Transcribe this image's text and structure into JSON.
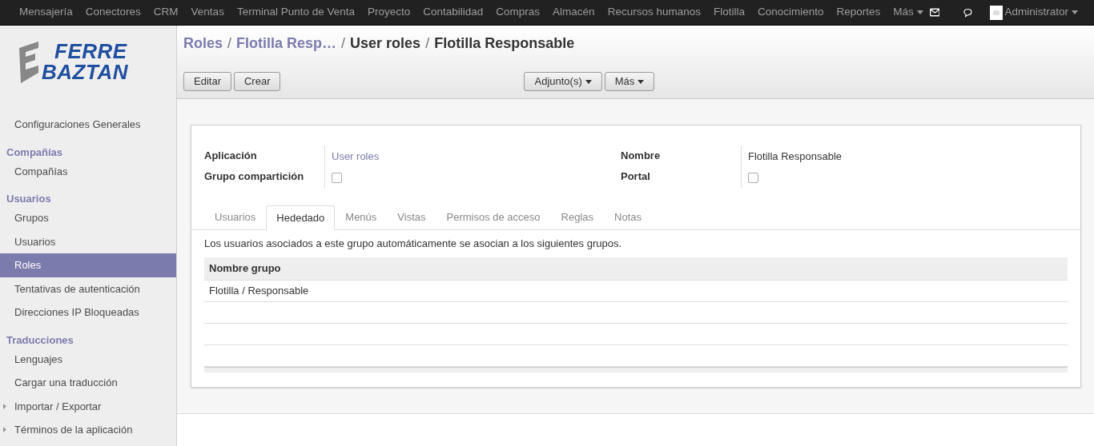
{
  "topbar": {
    "menu": [
      "Mensajería",
      "Conectores",
      "CRM",
      "Ventas",
      "Terminal Punto de Venta",
      "Proyecto",
      "Contabilidad",
      "Compras",
      "Almacén",
      "Recursos humanos",
      "Flotilla",
      "Conocimiento",
      "Reportes"
    ],
    "more": "Más",
    "user": "Administrator"
  },
  "logo": {
    "line1": "FERRE",
    "line2": "BAZTAN"
  },
  "sidebar": {
    "items": [
      {
        "kind": "item",
        "label": "Configuraciones Generales",
        "selected": false
      },
      {
        "kind": "header",
        "label": "Compañías"
      },
      {
        "kind": "item",
        "label": "Compañías",
        "selected": false
      },
      {
        "kind": "header",
        "label": "Usuarios"
      },
      {
        "kind": "item",
        "label": "Grupos",
        "selected": false
      },
      {
        "kind": "item",
        "label": "Usuarios",
        "selected": false
      },
      {
        "kind": "item",
        "label": "Roles",
        "selected": true
      },
      {
        "kind": "item",
        "label": "Tentativas de autenticación",
        "selected": false
      },
      {
        "kind": "item",
        "label": "Direcciones IP Bloqueadas",
        "selected": false
      },
      {
        "kind": "header",
        "label": "Traducciones"
      },
      {
        "kind": "item",
        "label": "Lenguajes",
        "selected": false
      },
      {
        "kind": "item",
        "label": "Cargar una traducción",
        "selected": false
      },
      {
        "kind": "folder",
        "label": "Importar / Exportar",
        "selected": false
      },
      {
        "kind": "folder",
        "label": "Términos de la aplicación",
        "selected": false
      }
    ]
  },
  "breadcrumb_separator": "/",
  "breadcrumbs": [
    {
      "label": "Roles",
      "link": true
    },
    {
      "label": "Flotilla Resp…",
      "link": true
    },
    {
      "label": "User roles",
      "link": false
    },
    {
      "label": "Flotilla Responsable",
      "link": false
    }
  ],
  "buttons": {
    "edit": "Editar",
    "create": "Crear",
    "attachments": "Adjunto(s)",
    "more": "Más"
  },
  "form": {
    "left": [
      {
        "label": "Aplicación",
        "kind": "link",
        "value": "User roles"
      },
      {
        "label": "Grupo compartición",
        "kind": "checkbox",
        "checked": false
      }
    ],
    "right": [
      {
        "label": "Nombre",
        "kind": "text",
        "value": "Flotilla Responsable"
      },
      {
        "label": "Portal",
        "kind": "checkbox",
        "checked": false
      }
    ]
  },
  "tabs": [
    {
      "label": "Usuarios",
      "selected": false
    },
    {
      "label": "Hededado",
      "selected": true
    },
    {
      "label": "Menús",
      "selected": false
    },
    {
      "label": "Vistas",
      "selected": false
    },
    {
      "label": "Permisos de acceso",
      "selected": false
    },
    {
      "label": "Reglas",
      "selected": false
    },
    {
      "label": "Notas",
      "selected": false
    }
  ],
  "tab_text": "Los usuarios asociados a este grupo automáticamente se asocian a los siguientes grupos.",
  "table": {
    "columns": [
      "Nombre grupo"
    ],
    "rows": [
      [
        "Flotilla / Responsable"
      ]
    ]
  }
}
